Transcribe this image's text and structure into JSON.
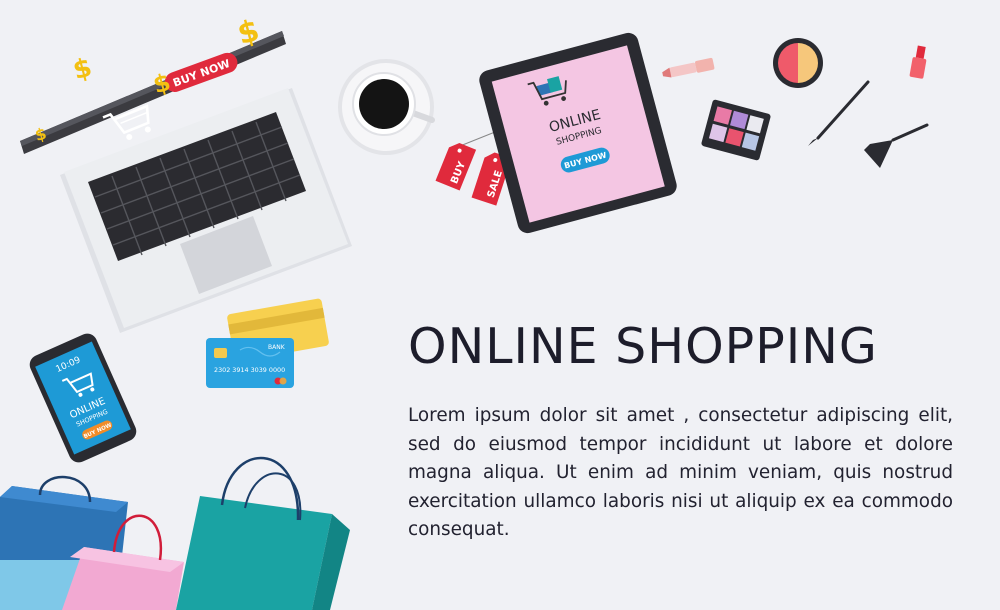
{
  "headline": "ONLINE SHOPPING",
  "body_text": "Lorem ipsum dolor sit amet , consectetur  adipiscing elit, sed do eiusmod tempor  incididunt  ut  labore et dolore magna aliqua. Ut enim ad minim veniam, quis nostrud exercitation ullamco laboris  nisi  ut  aliquip ex ea commodo consequat.",
  "laptop": {
    "button": "BUY NOW",
    "dollar": "$"
  },
  "tablet": {
    "line1": "ONLINE",
    "line2": "SHOPPING",
    "button": "BUY NOW"
  },
  "tags": {
    "buy": "BUY",
    "sale": "SALE"
  },
  "phone": {
    "time": "10:09",
    "line1": "ONLINE",
    "line2": "SHOPPING",
    "button": "BUY NOW"
  },
  "card": {
    "bank": "BANK",
    "number": "2302  3914  3039  0000"
  },
  "colors": {
    "background": "#f0f1f5",
    "accent_red": "#e02a3c",
    "accent_blue": "#1e9ad6",
    "tablet_screen": "#f4c6e3",
    "bag_teal": "#1aa3a3",
    "bag_pink": "#f2a9d2",
    "bag_blue": "#2d74b5"
  }
}
